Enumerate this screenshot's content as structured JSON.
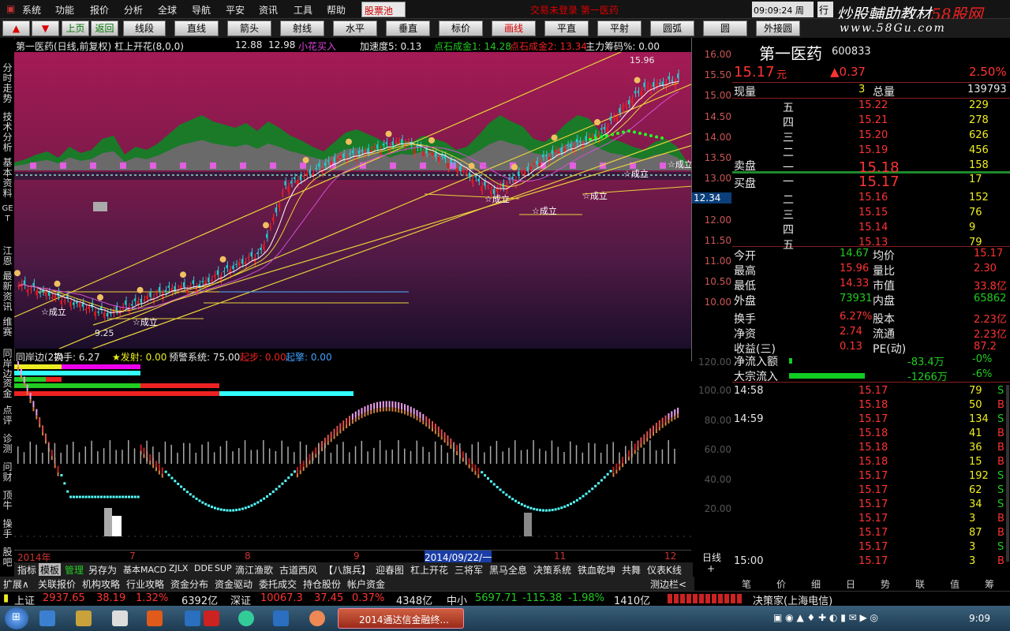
{
  "menu": {
    "items": [
      "系统",
      "功能",
      "报价",
      "分析",
      "全球",
      "导航",
      "平安",
      "资讯",
      "工具",
      "帮助"
    ],
    "stock_pool": "股票池",
    "notice": "交易未登录  第一医药",
    "clock": "09:09:24",
    "weekday": "周六",
    "extra": "行"
  },
  "watermark": {
    "t1": "炒股輔助教材",
    "t2": "58股网",
    "url": "www.58Gu.com"
  },
  "toolbar": {
    "up": "上页",
    "down": "下页",
    "back": "返回",
    "tools": [
      "线段",
      "直线",
      "箭头",
      "射线",
      "水平",
      "垂直",
      "标价",
      "画线",
      "平直",
      "平射",
      "圆弧",
      "圆",
      "外接圆"
    ]
  },
  "sidebar": [
    "分时走势",
    "技术分析",
    "基本资料",
    "GET",
    "江恩",
    "最新资讯",
    "维赛",
    "同岸边",
    "资金",
    "点评",
    "诊测",
    "问财",
    "顶牛",
    "操手",
    "股吧"
  ],
  "title_line": {
    "name": "第一医药(日线,前复权) 杠上开花(8,0,0)",
    "v1": "12.88",
    "v2": "12.98",
    "buy": "小花买入",
    "speed": "加速度5: 0.13",
    "stone1": "点石成金1: 14.28",
    "stone2": "点石成金2: 13.34",
    "chip": "主力筹码%: 0.00"
  },
  "price_axis": [
    "16.00",
    "15.50",
    "15.00",
    "14.50",
    "14.00",
    "13.50",
    "13.00",
    "12.34",
    "12.00",
    "11.50",
    "11.00",
    "10.50",
    "10.00"
  ],
  "price_labels": {
    "high": "15.96",
    "low": "9.25",
    "formed": "☆成立"
  },
  "indicator_line": {
    "name": "同岸边(27)",
    "hs": "换手: 6.27",
    "launch": "★发射: 0.00",
    "warn": "预警系统: 75.00",
    "jump": "起步: 0.00",
    "start": "起擎: 0.00"
  },
  "ind_axis": [
    "120.00",
    "100.00",
    "80.00",
    "60.00",
    "40.00",
    "20.00"
  ],
  "dates": [
    "2014年",
    "7",
    "8",
    "9",
    "2014/09/22/一",
    "11",
    "12"
  ],
  "axis_bottom": "日线",
  "tabs1": [
    "指标",
    "模板",
    "管理",
    "另存为",
    "基本MACD",
    "ZJLX",
    "DDE",
    "SUP",
    "滴江渔歌",
    "古道西风",
    "【八旗兵】",
    "迎春图",
    "杠上开花",
    "三将军",
    "黑马全息",
    "决策系统",
    "铁血乾坤",
    "共舞",
    "仪表K线"
  ],
  "tabs1_ctrl": [
    "+",
    "0"
  ],
  "tabs2": [
    "扩展∧",
    "关联报价",
    "机构攻略",
    "行业攻略",
    "资金分布",
    "资金驱动",
    "委托成交",
    "持仓股份",
    "帐户资金"
  ],
  "tabs2_right": "测边栏<",
  "quote": {
    "name": "第一医药",
    "code": "600833",
    "price": "15.17",
    "unit": "元",
    "change": "▲0.37",
    "pct": "2.50%",
    "now_l": "现量",
    "now_v": "3",
    "total_l": "总量",
    "total_v": "139793",
    "sell": [
      [
        "五",
        "15.22",
        "229"
      ],
      [
        "四",
        "15.21",
        "278"
      ],
      [
        "三",
        "15.20",
        "626"
      ],
      [
        "二",
        "15.19",
        "456"
      ],
      [
        "一",
        "15.18",
        "158"
      ]
    ],
    "sell_label": "卖盘",
    "buy_label": "买盘",
    "buy": [
      [
        "一",
        "15.17",
        "17"
      ],
      [
        "二",
        "15.16",
        "152"
      ],
      [
        "三",
        "15.15",
        "76"
      ],
      [
        "四",
        "15.14",
        "9"
      ],
      [
        "五",
        "15.13",
        "79"
      ]
    ],
    "stats": [
      [
        "今开",
        "14.67",
        "均价",
        "15.17"
      ],
      [
        "最高",
        "15.96",
        "量比",
        "2.30"
      ],
      [
        "最低",
        "14.33",
        "市值",
        "33.8亿"
      ],
      [
        "外盘",
        "73931",
        "内盘",
        "65862"
      ],
      [
        "换手",
        "6.27%",
        "股本",
        "2.23亿"
      ],
      [
        "净资",
        "2.74",
        "流通",
        "2.23亿"
      ],
      [
        "收益(三)",
        "0.13",
        "PE(动)",
        "87.2"
      ]
    ],
    "flow": [
      [
        "净流入额",
        "-83.4万",
        "-0%"
      ],
      [
        "大宗流入",
        "-1266万",
        "-6%"
      ]
    ],
    "ticks": [
      [
        "14:58",
        "15.17",
        "79",
        "S"
      ],
      [
        "",
        "15.18",
        "50",
        "B"
      ],
      [
        "14:59",
        "15.17",
        "134",
        "S"
      ],
      [
        "",
        "15.18",
        "41",
        "B"
      ],
      [
        "",
        "15.18",
        "36",
        "B"
      ],
      [
        "",
        "15.18",
        "15",
        "B"
      ],
      [
        "",
        "15.17",
        "192",
        "S"
      ],
      [
        "",
        "15.17",
        "62",
        "S"
      ],
      [
        "",
        "15.17",
        "34",
        "S"
      ],
      [
        "",
        "15.17",
        "3",
        "B"
      ],
      [
        "",
        "15.17",
        "87",
        "B"
      ],
      [
        "",
        "15.17",
        "3",
        "S"
      ],
      [
        "15:00",
        "15.17",
        "3",
        "B"
      ]
    ],
    "tabs": [
      "笔",
      "价",
      "细",
      "日",
      "势",
      "联",
      "值",
      "筹"
    ]
  },
  "status": {
    "sh_l": "上证",
    "sh_v": "2937.65",
    "sh_c": "38.19",
    "sh_p": "1.32%",
    "sh_a": "6392亿",
    "sz_l": "深证",
    "sz_v": "10067.3",
    "sz_c": "37.45",
    "sz_p": "0.37%",
    "sz_a": "4348亿",
    "zx_l": "中小",
    "zx_v": "5697.71",
    "zx_c": "-115.38",
    "zx_p": "-1.98%",
    "zx_a": "1410亿",
    "right": "决策家(上海电信)"
  },
  "taskbar": {
    "app": "2014通达信金融终...",
    "time": "9:09"
  }
}
